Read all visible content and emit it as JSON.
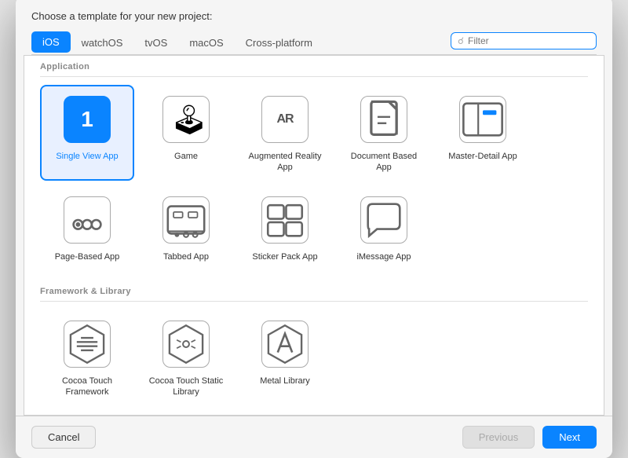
{
  "dialog": {
    "title": "Choose a template for your new project:",
    "filter_placeholder": "Filter"
  },
  "tabs": [
    {
      "label": "iOS",
      "active": true
    },
    {
      "label": "watchOS",
      "active": false
    },
    {
      "label": "tvOS",
      "active": false
    },
    {
      "label": "macOS",
      "active": false
    },
    {
      "label": "Cross-platform",
      "active": false
    }
  ],
  "sections": [
    {
      "name": "Application",
      "templates": [
        {
          "id": "single-view",
          "name": "Single View App",
          "selected": true,
          "icon": "number1"
        },
        {
          "id": "game",
          "name": "Game",
          "selected": false,
          "icon": "game"
        },
        {
          "id": "ar",
          "name": "Augmented Reality App",
          "selected": false,
          "icon": "ar"
        },
        {
          "id": "document",
          "name": "Document Based App",
          "selected": false,
          "icon": "document"
        },
        {
          "id": "master-detail",
          "name": "Master-Detail App",
          "selected": false,
          "icon": "masterdetail"
        },
        {
          "id": "page-based",
          "name": "Page-Based App",
          "selected": false,
          "icon": "pagebased"
        },
        {
          "id": "tabbed",
          "name": "Tabbed App",
          "selected": false,
          "icon": "tabbed"
        },
        {
          "id": "sticker-pack",
          "name": "Sticker Pack App",
          "selected": false,
          "icon": "sticker"
        },
        {
          "id": "imessage",
          "name": "iMessage App",
          "selected": false,
          "icon": "imessage"
        }
      ]
    },
    {
      "name": "Framework & Library",
      "templates": [
        {
          "id": "cocoa-framework",
          "name": "Cocoa Touch Framework",
          "selected": false,
          "icon": "hexframe"
        },
        {
          "id": "cocoa-static",
          "name": "Cocoa Touch Static Library",
          "selected": false,
          "icon": "hexstatic"
        },
        {
          "id": "metal",
          "name": "Metal Library",
          "selected": false,
          "icon": "metal"
        }
      ]
    }
  ],
  "footer": {
    "cancel_label": "Cancel",
    "previous_label": "Previous",
    "next_label": "Next"
  }
}
